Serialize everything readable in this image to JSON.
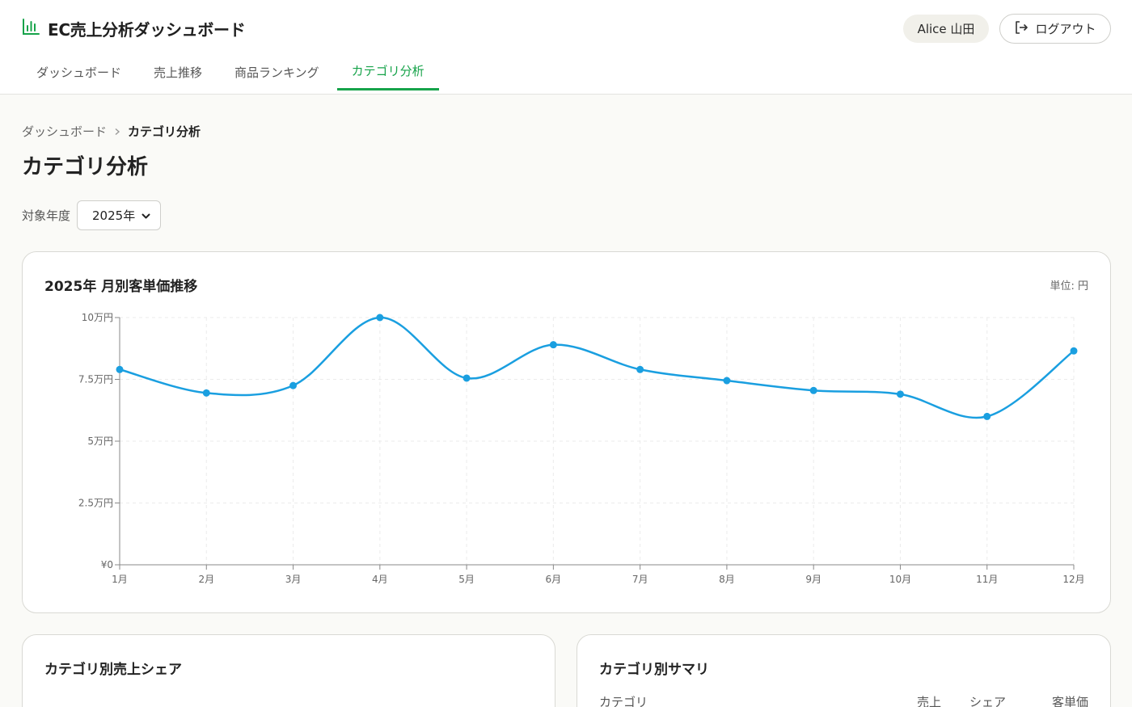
{
  "header": {
    "app_title": "EC売上分析ダッシュボード",
    "user_name": "Alice 山田",
    "logout_label": "ログアウト"
  },
  "tabs": [
    {
      "label": "ダッシュボード",
      "active": false
    },
    {
      "label": "売上推移",
      "active": false
    },
    {
      "label": "商品ランキング",
      "active": false
    },
    {
      "label": "カテゴリ分析",
      "active": true
    }
  ],
  "breadcrumb": {
    "parent": "ダッシュボード",
    "current": "カテゴリ分析"
  },
  "page_title": "カテゴリ分析",
  "filter": {
    "label": "対象年度",
    "selected": "2025年"
  },
  "chart_card": {
    "title": "2025年 月別客単価推移",
    "unit": "単位: 円"
  },
  "chart_data": {
    "type": "line",
    "title": "2025年 月別客単価推移",
    "categories": [
      "1月",
      "2月",
      "3月",
      "4月",
      "5月",
      "6月",
      "7月",
      "8月",
      "9月",
      "10月",
      "11月",
      "12月"
    ],
    "series": [
      {
        "values": [
          79000,
          69500,
          72500,
          100000,
          75500,
          89000,
          79000,
          74500,
          70500,
          69000,
          60000,
          86500
        ]
      }
    ],
    "ylim": [
      0,
      100000
    ],
    "yticks": [
      0,
      25000,
      50000,
      75000,
      100000
    ],
    "ytick_labels": [
      "¥0",
      "2.5万円",
      "5万円",
      "7.5万円",
      "10万円"
    ],
    "grid": true,
    "line_color": "#1a9fe0"
  },
  "share_card": {
    "title": "カテゴリ別売上シェア"
  },
  "summary_card": {
    "title": "カテゴリ別サマリ",
    "columns": [
      "カテゴリ",
      "売上",
      "シェア",
      "客単価"
    ]
  },
  "colors": {
    "accent": "#16a34a",
    "line": "#1a9fe0"
  }
}
